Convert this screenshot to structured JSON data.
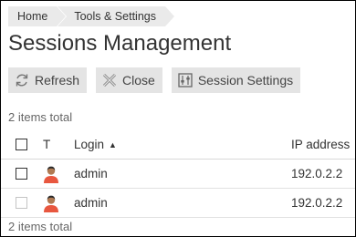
{
  "breadcrumb": {
    "items": [
      "Home",
      "Tools & Settings"
    ]
  },
  "page_title": "Sessions Management",
  "toolbar": {
    "refresh_label": "Refresh",
    "close_label": "Close",
    "settings_label": "Session Settings"
  },
  "items_total_top": "2 items total",
  "items_total_bottom": "2 items total",
  "table": {
    "columns": {
      "type": "T",
      "login": "Login",
      "ip": "IP address"
    },
    "sort_indicator": "▲",
    "rows": [
      {
        "login": "admin",
        "ip": "192.0.2.2",
        "icon": "user-icon"
      },
      {
        "login": "admin",
        "ip": "192.0.2.2",
        "icon": "user-icon"
      }
    ]
  },
  "colors": {
    "button_bg": "#e4e4e4",
    "breadcrumb_bg": "#eaeaea",
    "avatar_shirt": "#e8573f"
  }
}
